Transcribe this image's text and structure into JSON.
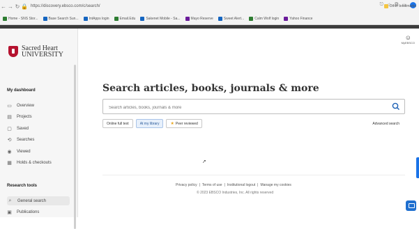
{
  "browser": {
    "url": "https://discovery.ebsco.com/c/search/",
    "bookmarks": [
      {
        "label": "Home - SNS Stor...",
        "color": "#2e7d32"
      },
      {
        "label": "Base Search Sun...",
        "color": "#1565c0"
      },
      {
        "label": "IntApps login",
        "color": "#1565c0"
      },
      {
        "label": "Email.Edu",
        "color": "#2e7d32"
      },
      {
        "label": "Sakenet Mobile - Sa...",
        "color": "#1565c0"
      },
      {
        "label": "Mayo Reserve",
        "color": "#6a1b9a"
      },
      {
        "label": "Sweet Alert...",
        "color": "#1565c0"
      },
      {
        "label": "Calm Wolf login",
        "color": "#2e7d32"
      },
      {
        "label": "Yahoo Finance",
        "color": "#6a1b9a"
      }
    ],
    "other_bookmarks": "Other bookmarks"
  },
  "sidebar": {
    "logo_line1": "Sacred Heart",
    "logo_line2": "UNIVERSITY",
    "section1_title": "My dashboard",
    "section1_items": [
      {
        "label": "Overview",
        "icon": "▭"
      },
      {
        "label": "Projects",
        "icon": "▤"
      },
      {
        "label": "Saved",
        "icon": "▢"
      },
      {
        "label": "Searches",
        "icon": "⟲"
      },
      {
        "label": "Viewed",
        "icon": "◉"
      },
      {
        "label": "Holds & checkouts",
        "icon": "▦"
      }
    ],
    "section2_title": "Research tools",
    "section2_items": [
      {
        "label": "General search",
        "icon": "⌕"
      },
      {
        "label": "Publications",
        "icon": "▣"
      }
    ]
  },
  "user": {
    "label": "MyEBSCO"
  },
  "main": {
    "title": "Search articles, books, journals & more",
    "search_placeholder": "Search articles, books, journals & more",
    "filters": [
      "Online full text",
      "At my library",
      "Peer reviewed"
    ],
    "advanced_search": "Advanced search"
  },
  "footer": {
    "links": [
      "Privacy policy",
      "Terms of use",
      "Institutional logout",
      "Manage my cookies"
    ],
    "copyright": "© 2023 EBSCO Industries, Inc. All rights reserved"
  }
}
